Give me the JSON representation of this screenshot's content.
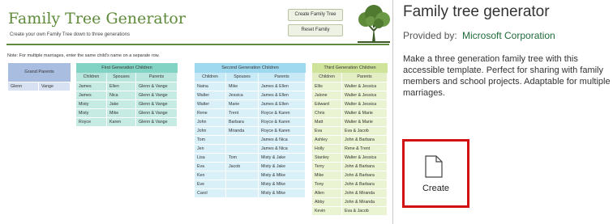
{
  "preview": {
    "title": "Family Tree Generator",
    "subtitle": "Create your own Family Tree down to three generations",
    "create_button": "Create Family Tree",
    "reset_button": "Reset Family",
    "note": "Note: For multiple marriages, enter the same child's name on a separate row.",
    "grandparents": {
      "header": "Grand Parents",
      "rows": [
        [
          "Glenn",
          "Vange"
        ]
      ]
    },
    "first_generation": {
      "header": "First Generation Children",
      "columns": [
        "Children",
        "Spouses",
        "Parents"
      ],
      "rows": [
        [
          "James",
          "Ellen",
          "Glenn & Vange"
        ],
        [
          "James",
          "Nica",
          "Glenn & Vange"
        ],
        [
          "Misty",
          "Jake",
          "Glenn & Vange"
        ],
        [
          "Misty",
          "Mike",
          "Glenn & Vange"
        ],
        [
          "Royce",
          "Karen",
          "Glenn & Vange"
        ]
      ]
    },
    "second_generation": {
      "header": "Second Generation Children",
      "columns": [
        "Children",
        "Spouses",
        "Parents"
      ],
      "rows": [
        [
          "Naina",
          "Mike",
          "James & Ellen"
        ],
        [
          "Walter",
          "Jessica",
          "James & Ellen"
        ],
        [
          "Walter",
          "Marie",
          "James & Ellen"
        ],
        [
          "Rene",
          "Trent",
          "Royce & Karen"
        ],
        [
          "John",
          "Barbara",
          "Royce & Karen"
        ],
        [
          "John",
          "Miranda",
          "Royce & Karen"
        ],
        [
          "Tom",
          "",
          "James & Nica"
        ],
        [
          "Jen",
          "",
          "James & Nica"
        ],
        [
          "Lisa",
          "Tom",
          "Misty & Jake"
        ],
        [
          "Eva",
          "Jacob",
          "Misty & Jake"
        ],
        [
          "Ken",
          "",
          "Misty & Mike"
        ],
        [
          "Eve",
          "",
          "Misty & Mike"
        ],
        [
          "Carol",
          "",
          "Misty & Mike"
        ]
      ]
    },
    "third_generation": {
      "header": "Third Generation Children",
      "columns": [
        "Children",
        "Parents"
      ],
      "rows": [
        [
          "Ellis",
          "Walter & Jessica"
        ],
        [
          "Jalone",
          "Walter & Jessica"
        ],
        [
          "Edward",
          "Walter & Jessica"
        ],
        [
          "Chris",
          "Walter & Marie"
        ],
        [
          "Matt",
          "Walter & Marie"
        ],
        [
          "Eva",
          "Eva & Jacob"
        ],
        [
          "Ashley",
          "John & Barbara"
        ],
        [
          "Holly",
          "Rene & Trent"
        ],
        [
          "Stanley",
          "Walter & Jessica"
        ],
        [
          "Terry",
          "John & Barbara"
        ],
        [
          "Mike",
          "John & Barbara"
        ],
        [
          "Tony",
          "John & Barbara"
        ],
        [
          "Allen",
          "John & Miranda"
        ],
        [
          "Abby",
          "John & Miranda"
        ],
        [
          "Kevin",
          "Eva & Jacob"
        ]
      ]
    }
  },
  "info": {
    "title": "Family tree generator",
    "provided_by_label": "Provided by:",
    "provider": "Microsoft Corporation",
    "description": "Make a three generation family tree with this accessible template. Perfect for sharing with family members and school projects. Adaptable for multiple marriages.",
    "create_label": "Create",
    "icon": "document-icon"
  },
  "colors": {
    "accent_green": "#5e8a3a",
    "provider_link": "#1f6b3a",
    "create_border": "#d21212"
  }
}
